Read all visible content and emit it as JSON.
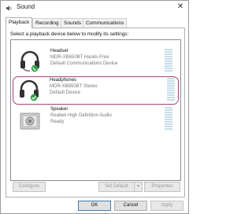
{
  "window": {
    "title": "Sound",
    "close_glyph": "✕"
  },
  "tabs": [
    {
      "label": "Playback"
    },
    {
      "label": "Recording"
    },
    {
      "label": "Sounds"
    },
    {
      "label": "Communications"
    }
  ],
  "instruction": "Select a playback device below to modify its settings:",
  "devices": [
    {
      "name": "Headset",
      "description": "MDR-XB650BT Hands-Free",
      "status": "Default Communications Device",
      "icon": "headset-icon",
      "badge": "phone-badge-icon"
    },
    {
      "name": "Headphones",
      "description": "MDR-XB650BT Stereo",
      "status": "Default Device",
      "icon": "headphones-icon",
      "badge": "checkmark-badge-icon",
      "selected": true
    },
    {
      "name": "Speaker",
      "description": "Realtek High Definition Audio",
      "status": "Ready",
      "icon": "speaker-icon"
    }
  ],
  "buttons": {
    "configure": "Configure",
    "set_default": "Set Default",
    "dropdown_glyph": "▼",
    "properties": "Properties",
    "ok": "OK",
    "cancel": "Cancel",
    "apply": "Apply"
  },
  "colors": {
    "selection_border": "#a64476",
    "badge_green": "#2ea043",
    "meter": "#c7dde8"
  }
}
